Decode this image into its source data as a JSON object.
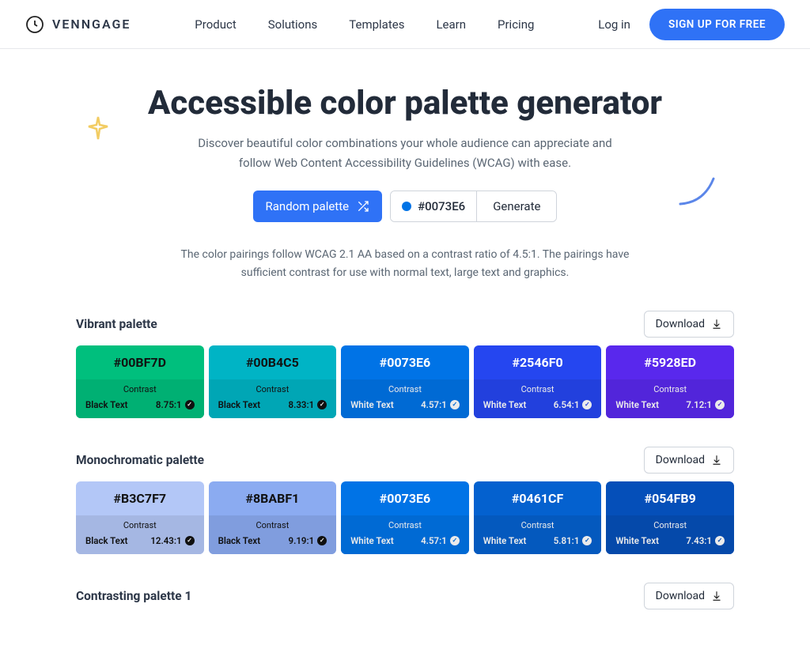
{
  "brand": "VENNGAGE",
  "nav": {
    "items": [
      "Product",
      "Solutions",
      "Templates",
      "Learn",
      "Pricing"
    ],
    "login": "Log in",
    "signup": "SIGN UP FOR FREE"
  },
  "hero": {
    "title": "Accessible color palette generator",
    "subtitle": "Discover beautiful color combinations your whole audience can appreciate and follow Web Content Accessibility Guidelines (WCAG) with ease.",
    "random_label": "Random palette",
    "hex_value": "#0073E6",
    "swatch_color": "#0073E6",
    "generate_label": "Generate",
    "note": "The color pairings follow WCAG 2.1 AA based on a contrast ratio of 4.5:1. The pairings have sufficient contrast for use with normal text, large text and graphics."
  },
  "download_label": "Download",
  "contrast_label": "Contrast",
  "palettes": [
    {
      "name": "Vibrant palette",
      "colors": [
        {
          "hex": "#00BF7D",
          "text_label": "Black Text",
          "ratio": "8.75:1",
          "text_mode": "dark"
        },
        {
          "hex": "#00B4C5",
          "text_label": "Black Text",
          "ratio": "8.33:1",
          "text_mode": "dark"
        },
        {
          "hex": "#0073E6",
          "text_label": "White Text",
          "ratio": "4.57:1",
          "text_mode": "light"
        },
        {
          "hex": "#2546F0",
          "text_label": "White Text",
          "ratio": "6.54:1",
          "text_mode": "light"
        },
        {
          "hex": "#5928ED",
          "text_label": "White Text",
          "ratio": "7.12:1",
          "text_mode": "light"
        }
      ]
    },
    {
      "name": "Monochromatic palette",
      "colors": [
        {
          "hex": "#B3C7F7",
          "text_label": "Black Text",
          "ratio": "12.43:1",
          "text_mode": "dark"
        },
        {
          "hex": "#8BABF1",
          "text_label": "Black Text",
          "ratio": "9.19:1",
          "text_mode": "dark"
        },
        {
          "hex": "#0073E6",
          "text_label": "White Text",
          "ratio": "4.57:1",
          "text_mode": "light"
        },
        {
          "hex": "#0461CF",
          "text_label": "White Text",
          "ratio": "5.81:1",
          "text_mode": "light"
        },
        {
          "hex": "#054FB9",
          "text_label": "White Text",
          "ratio": "7.43:1",
          "text_mode": "light"
        }
      ]
    },
    {
      "name": "Contrasting palette 1",
      "colors": []
    }
  ]
}
